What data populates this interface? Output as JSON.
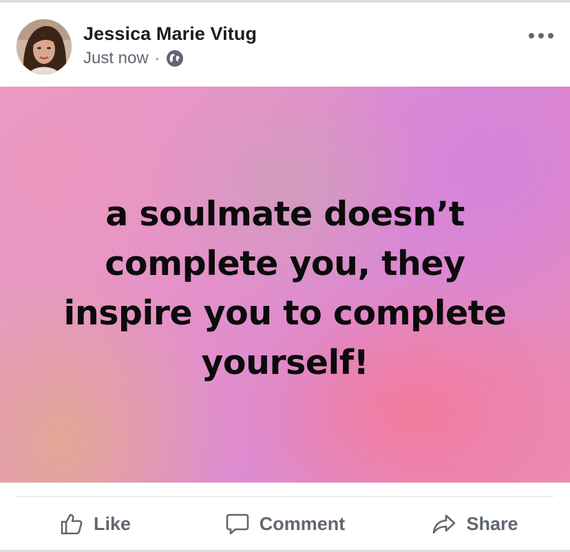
{
  "post": {
    "author_name": "Jessica Marie Vitug",
    "timestamp": "Just now",
    "separator": "·",
    "privacy_icon": "globe-icon",
    "more_icon": "more-options-icon",
    "background_colors": [
      "#e89ec6",
      "#dc8bd0",
      "#f678a0",
      "#e1aa8c"
    ],
    "text_lines": [
      "a soulmate doesn’t",
      "complete you, they",
      "inspire you to complete",
      "yourself!"
    ]
  },
  "actions": {
    "like_label": "Like",
    "comment_label": "Comment",
    "share_label": "Share",
    "text_color": "#606770"
  }
}
